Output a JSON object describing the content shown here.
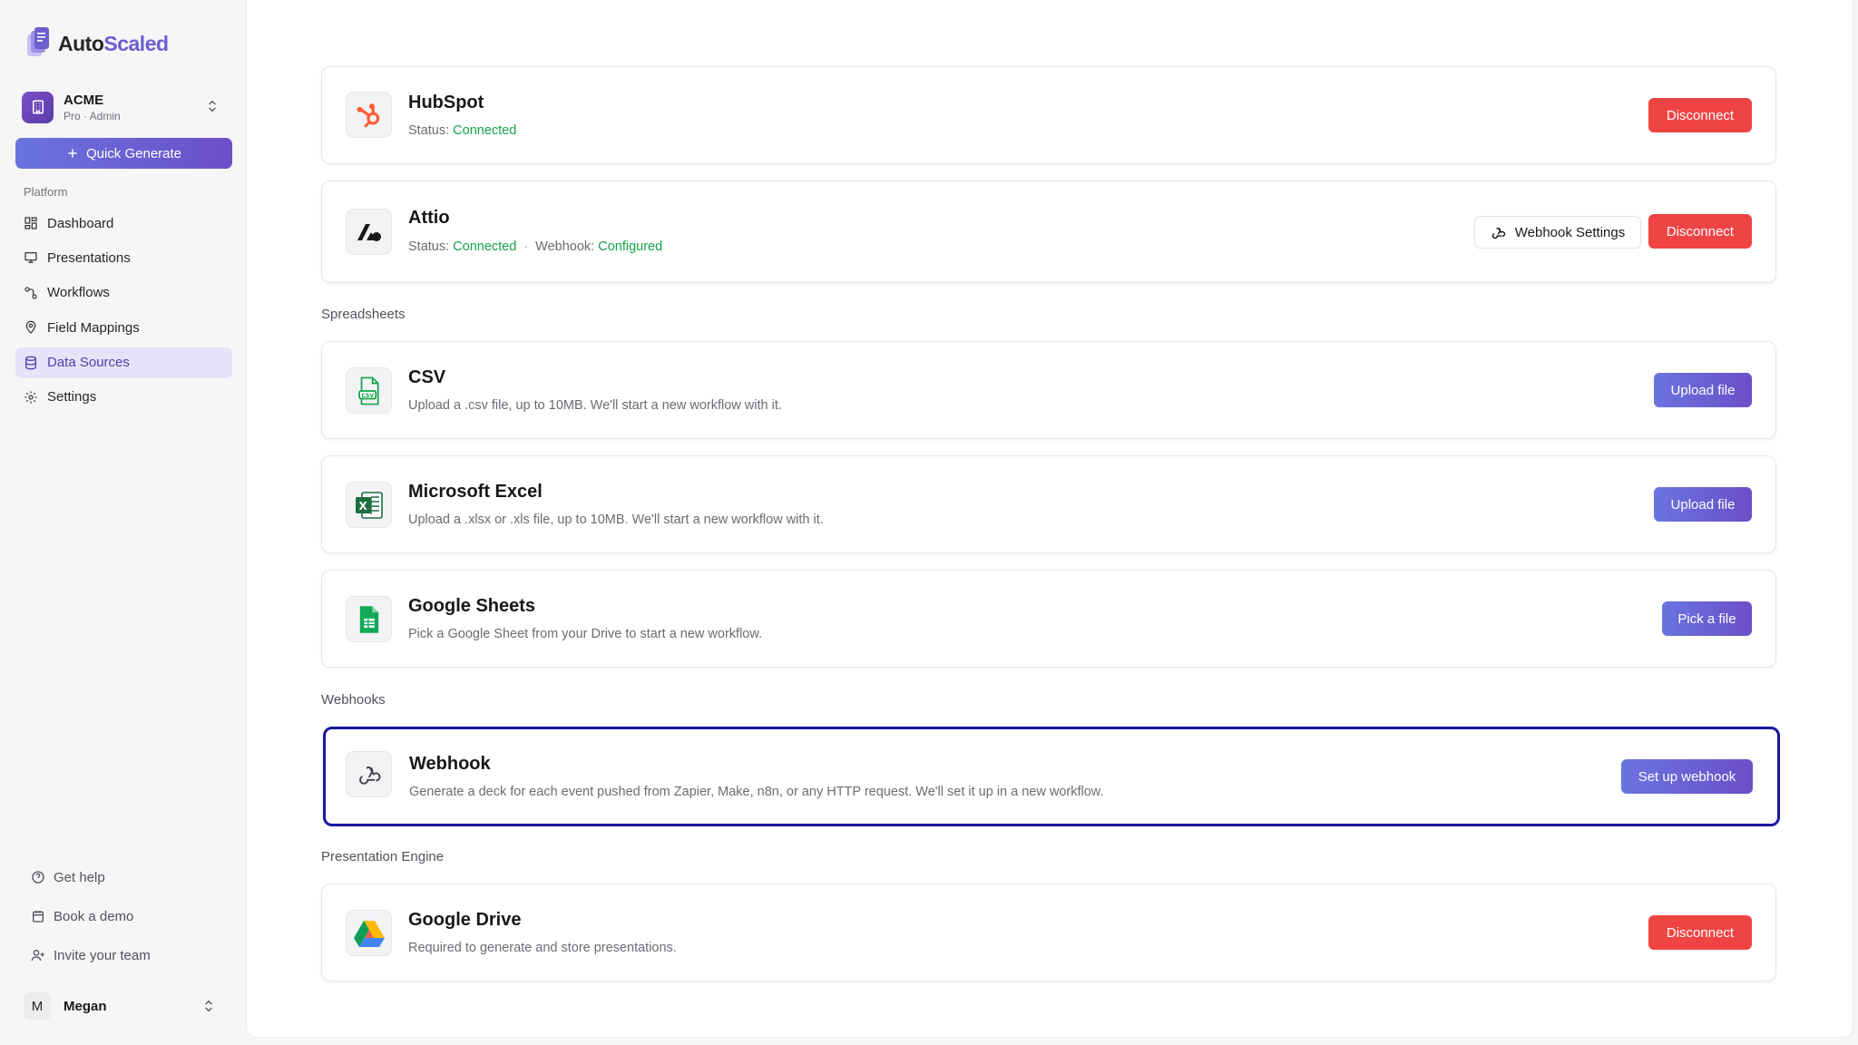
{
  "brand": {
    "name_part1": "Auto",
    "name_part2": "Scaled",
    "accent": "#6d5fd0"
  },
  "org": {
    "name": "ACME",
    "subtitle": "Pro · Admin"
  },
  "quick_generate": {
    "label": "Quick Generate"
  },
  "sidebar": {
    "section_label": "Platform",
    "items": [
      {
        "label": "Dashboard",
        "icon": "grid-icon",
        "active": false
      },
      {
        "label": "Presentations",
        "icon": "presentation-icon",
        "active": false
      },
      {
        "label": "Workflows",
        "icon": "workflow-icon",
        "active": false
      },
      {
        "label": "Field Mappings",
        "icon": "map-pin-icon",
        "active": false
      },
      {
        "label": "Data Sources",
        "icon": "database-icon",
        "active": true
      },
      {
        "label": "Settings",
        "icon": "gear-icon",
        "active": false
      }
    ],
    "bottom_links": [
      {
        "label": "Get help",
        "icon": "help-icon"
      },
      {
        "label": "Book a demo",
        "icon": "calendar-icon"
      },
      {
        "label": "Invite your team",
        "icon": "user-plus-icon"
      }
    ]
  },
  "user": {
    "initial": "M",
    "name": "Megan"
  },
  "groups": {
    "spreadsheets": "Spreadsheets",
    "webhooks": "Webhooks",
    "presentation_engine": "Presentation Engine"
  },
  "cards": {
    "hubspot": {
      "title": "HubSpot",
      "status_label": "Status:",
      "status": "Connected",
      "button": "Disconnect"
    },
    "attio": {
      "title": "Attio",
      "status_label": "Status:",
      "status": "Connected",
      "webhook_label": "Webhook:",
      "webhook_status": "Configured",
      "settings_button": "Webhook Settings",
      "button": "Disconnect"
    },
    "csv": {
      "title": "CSV",
      "desc": "Upload a .csv file, up to 10MB. We'll start a new workflow with it.",
      "button": "Upload file"
    },
    "excel": {
      "title": "Microsoft Excel",
      "desc": "Upload a .xlsx or .xls file, up to 10MB. We'll start a new workflow with it.",
      "button": "Upload file"
    },
    "sheets": {
      "title": "Google Sheets",
      "desc": "Pick a Google Sheet from your Drive to start a new workflow.",
      "button": "Pick a file"
    },
    "webhook": {
      "title": "Webhook",
      "desc": "Generate a deck for each event pushed from Zapier, Make, n8n, or any HTTP request. We'll set it up in a new workflow.",
      "button": "Set up webhook"
    },
    "gdrive": {
      "title": "Google Drive",
      "desc": "Required to generate and store presentations.",
      "button": "Disconnect"
    }
  },
  "colors": {
    "connected": "#16a34a",
    "danger": "#ef4444",
    "highlight_border": "#1a16a0"
  }
}
